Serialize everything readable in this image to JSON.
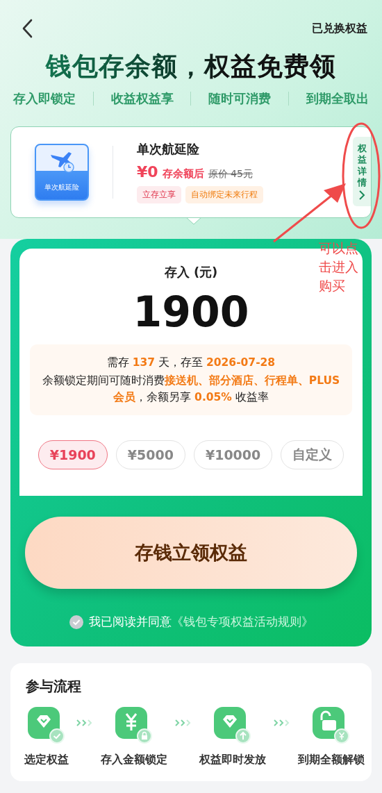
{
  "header": {
    "link": "已兑换权益"
  },
  "headline": "钱包存余额，权益免费领",
  "features": [
    "存入即锁定",
    "收益权益享",
    "随时可消费",
    "到期全取出"
  ],
  "product": {
    "tile_label": "单次航延险",
    "name": "单次航延险",
    "price": "¥0",
    "price_note": "存余额后",
    "original_price": "原价 45元",
    "tags": [
      {
        "label": "立存立享",
        "kind": "red"
      },
      {
        "label": "自动绑定未来行程",
        "kind": "orange"
      }
    ],
    "details": "权益详情"
  },
  "deposit": {
    "label": "存入 (元)",
    "amount": "1900",
    "info_line": "需存 **137** 天，存至 **2026-07-28**",
    "info_text": "余额锁定期间可随时消费**接送机、部分酒店、行程单、PLUS会员**，余额另享 **0.05%** 收益率",
    "options": [
      {
        "label": "¥1900",
        "selected": true
      },
      {
        "label": "¥5000",
        "selected": false
      },
      {
        "label": "¥10000",
        "selected": false
      },
      {
        "label": "自定义",
        "selected": false
      }
    ],
    "submit": "存钱立领权益",
    "agreement": {
      "checked": false,
      "text": "我已阅读并同意",
      "link": "《钱包专项权益活动规则》"
    }
  },
  "flow": {
    "title": "参与流程",
    "steps": [
      {
        "label": "选定权益",
        "kind": "select"
      },
      {
        "label": "存入金额锁定",
        "kind": "lock"
      },
      {
        "label": "权益即时发放",
        "kind": "issue"
      },
      {
        "label": "到期全额解锁",
        "kind": "unlock"
      }
    ]
  },
  "annotation": "可以点击进入购买"
}
